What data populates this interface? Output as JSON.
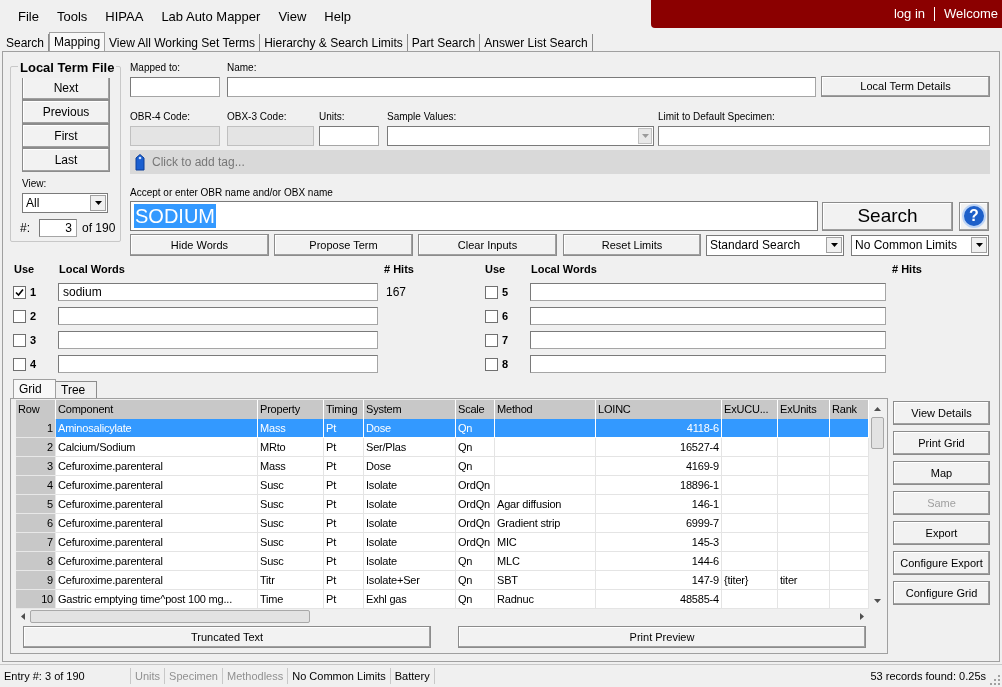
{
  "menu": [
    "File",
    "Tools",
    "HIPAA",
    "Lab Auto Mapper",
    "View",
    "Help"
  ],
  "account": {
    "links": [
      "log in",
      "Welcome"
    ]
  },
  "tabs": [
    {
      "label": "Search",
      "selected": false
    },
    {
      "label": "Mapping",
      "selected": true
    },
    {
      "label": "View All Working Set Terms",
      "selected": false
    },
    {
      "label": "Hierarchy & Search Limits",
      "selected": false
    },
    {
      "label": "Part Search",
      "selected": false
    },
    {
      "label": "Answer List Search",
      "selected": false
    }
  ],
  "local_term_file": {
    "title": "Local Term File",
    "buttons": [
      "Next",
      "Previous",
      "First",
      "Last"
    ],
    "view_label": "View:",
    "view_value": "All",
    "index_label": "#:",
    "index_value": "3",
    "index_total": "of 190"
  },
  "term": {
    "mapped_to": {
      "label": "Mapped to:"
    },
    "name": {
      "label": "Name:"
    },
    "details_button": "Local Term Details",
    "obr4": {
      "label": "OBR-4 Code:",
      "disabled": true
    },
    "obx3": {
      "label": "OBX-3 Code:",
      "disabled": true
    },
    "units": {
      "label": "Units:"
    },
    "sample_values": {
      "label": "Sample Values:"
    },
    "default_specimen": {
      "label": "Limit to Default Specimen:"
    },
    "tag_placeholder": "Click to add tag..."
  },
  "search": {
    "label": "Accept or enter OBR name and/or OBX name",
    "value": "SODIUM",
    "button": "Search",
    "help": "?",
    "actions": [
      "Hide Words",
      "Propose Term",
      "Clear Inputs",
      "Reset Limits"
    ],
    "mode": "Standard Search",
    "limits": "No Common Limits"
  },
  "word_columns": [
    {
      "use": "Use",
      "words": "Local Words",
      "hits": "# Hits",
      "rows": [
        {
          "number": "1",
          "checked": true,
          "value": "sodium",
          "hits": "167"
        },
        {
          "number": "2",
          "checked": false
        },
        {
          "number": "3",
          "checked": false
        },
        {
          "number": "4",
          "checked": false
        }
      ]
    },
    {
      "use": "Use",
      "words": "Local Words",
      "hits": "# Hits",
      "rows": [
        {
          "number": "5",
          "checked": false
        },
        {
          "number": "6",
          "checked": false
        },
        {
          "number": "7",
          "checked": false
        },
        {
          "number": "8",
          "checked": false
        }
      ]
    }
  ],
  "grid": {
    "tabs": [
      {
        "label": "Grid",
        "selected": true
      },
      {
        "label": "Tree",
        "selected": false
      }
    ],
    "columns": [
      "Row",
      "Component",
      "Property",
      "Timing",
      "System",
      "Scale",
      "Method",
      "LOINC",
      "ExUCU...",
      "ExUnits",
      "Rank"
    ],
    "rows": [
      {
        "selected": true,
        "row": "1",
        "component": "Aminosalicylate",
        "property": "Mass",
        "timing": "Pt",
        "system": "Dose",
        "scale": "Qn",
        "loinc": "4118-6"
      },
      {
        "selected": false,
        "row": "2",
        "component": "Calcium/Sodium",
        "property": "MRto",
        "timing": "Pt",
        "system": "Ser/Plas",
        "scale": "Qn",
        "loinc": "16527-4"
      },
      {
        "selected": false,
        "row": "3",
        "component": "Cefuroxime.parenteral",
        "property": "Mass",
        "timing": "Pt",
        "system": "Dose",
        "scale": "Qn",
        "loinc": "4169-9"
      },
      {
        "selected": false,
        "row": "4",
        "component": "Cefuroxime.parenteral",
        "property": "Susc",
        "timing": "Pt",
        "system": "Isolate",
        "scale": "OrdQn",
        "loinc": "18896-1"
      },
      {
        "selected": false,
        "row": "5",
        "component": "Cefuroxime.parenteral",
        "property": "Susc",
        "timing": "Pt",
        "system": "Isolate",
        "scale": "OrdQn",
        "method": "Agar diffusion",
        "loinc": "146-1"
      },
      {
        "selected": false,
        "row": "6",
        "component": "Cefuroxime.parenteral",
        "property": "Susc",
        "timing": "Pt",
        "system": "Isolate",
        "scale": "OrdQn",
        "method": "Gradient strip",
        "loinc": "6999-7"
      },
      {
        "selected": false,
        "row": "7",
        "component": "Cefuroxime.parenteral",
        "property": "Susc",
        "timing": "Pt",
        "system": "Isolate",
        "scale": "OrdQn",
        "method": "MIC",
        "loinc": "145-3"
      },
      {
        "selected": false,
        "row": "8",
        "component": "Cefuroxime.parenteral",
        "property": "Susc",
        "timing": "Pt",
        "system": "Isolate",
        "scale": "Qn",
        "method": "MLC",
        "loinc": "144-6"
      },
      {
        "selected": false,
        "row": "9",
        "component": "Cefuroxime.parenteral",
        "property": "Titr",
        "timing": "Pt",
        "system": "Isolate+Ser",
        "scale": "Qn",
        "method": "SBT",
        "loinc": "147-9",
        "exucum": "{titer}",
        "exunits": "titer"
      },
      {
        "selected": false,
        "row": "10",
        "component": "Gastric emptying time^post 100 mg...",
        "property": "Time",
        "timing": "Pt",
        "system": "Exhl gas",
        "scale": "Qn",
        "method": "Radnuc",
        "loinc": "48585-4"
      }
    ],
    "side_buttons": [
      {
        "label": "View Details",
        "disabled": false
      },
      {
        "label": "Print Grid",
        "disabled": false
      },
      {
        "label": "Map",
        "disabled": false
      },
      {
        "label": "Same",
        "disabled": true
      },
      {
        "label": "Export",
        "disabled": false
      },
      {
        "label": "Configure Export",
        "disabled": false
      },
      {
        "label": "Configure Grid",
        "disabled": false
      }
    ],
    "buttons": [
      "Truncated Text",
      "Print Preview"
    ]
  },
  "status_bar": {
    "items": [
      {
        "text": "Entry #: 3 of 190",
        "disabled": false
      },
      {
        "text": "Units",
        "disabled": true
      },
      {
        "text": "Specimen",
        "disabled": true
      },
      {
        "text": "Methodless",
        "disabled": true
      },
      {
        "text": "No Common Limits",
        "disabled": false
      },
      {
        "text": "Battery",
        "disabled": false
      }
    ],
    "summary": "53 records found: 0.25s"
  }
}
